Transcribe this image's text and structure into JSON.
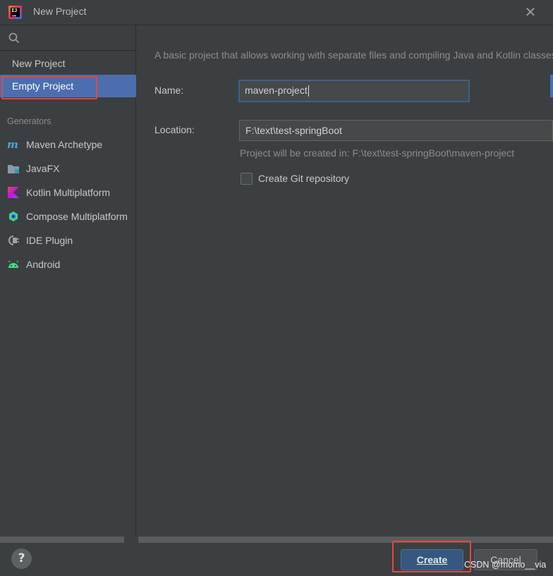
{
  "window": {
    "title": "New Project",
    "app_logo_text": "IJ"
  },
  "sidebar": {
    "search": {
      "value": "",
      "placeholder": ""
    },
    "items": [
      {
        "label": "New Project",
        "selected": false
      },
      {
        "label": "Empty Project",
        "selected": true
      }
    ],
    "generators_label": "Generators",
    "generators": [
      {
        "label": "Maven Archetype",
        "icon": "maven-icon"
      },
      {
        "label": "JavaFX",
        "icon": "folder-icon"
      },
      {
        "label": "Kotlin Multiplatform",
        "icon": "kotlin-icon"
      },
      {
        "label": "Compose Multiplatform",
        "icon": "compose-icon"
      },
      {
        "label": "IDE Plugin",
        "icon": "plugin-icon"
      },
      {
        "label": "Android",
        "icon": "android-icon"
      }
    ]
  },
  "main": {
    "description": "A basic project that allows working with separate files and compiling Java and Kotlin classes.",
    "name_label": "Name:",
    "name_value": "maven-project",
    "location_label": "Location:",
    "location_value": "F:\\text\\test-springBoot",
    "location_hint": "Project will be created in: F:\\text\\test-springBoot\\maven-project",
    "git_checkbox_label": "Create Git repository",
    "git_checked": false
  },
  "footer": {
    "help_label": "?",
    "create_label": "Create",
    "cancel_label": "Cancel",
    "watermark": "CSDN @momo__via"
  },
  "colors": {
    "background": "#3c3f41",
    "selection": "#4b6eaf",
    "primary_button": "#365880",
    "highlight_box": "#e4483e"
  }
}
